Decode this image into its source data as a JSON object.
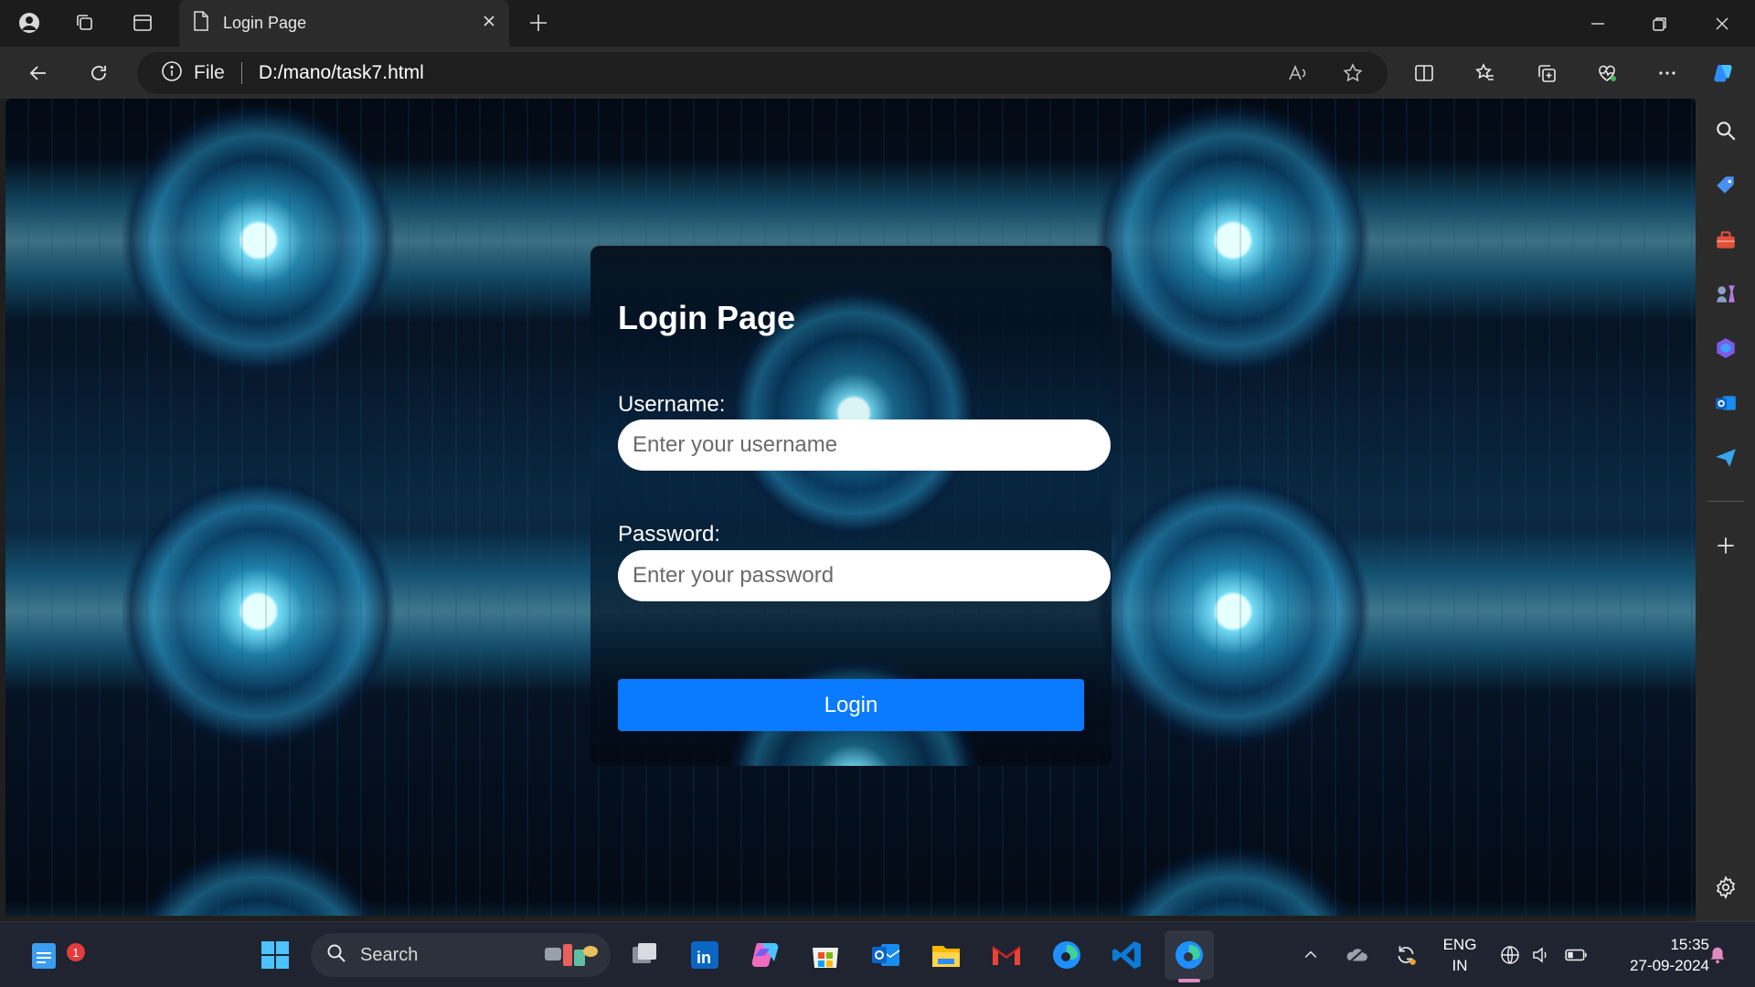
{
  "tab": {
    "title": "Login Page"
  },
  "address": {
    "scheme_label": "File",
    "url": "D:/mano/task7.html"
  },
  "page": {
    "title": "Login Page",
    "username_label": "Username:",
    "username_placeholder": "Enter your username",
    "password_label": "Password:",
    "password_placeholder": "Enter your password",
    "login_label": "Login"
  },
  "taskbar": {
    "search_label": "Search",
    "notification_count": "1",
    "lang_line1": "ENG",
    "lang_line2": "IN",
    "time": "15:35",
    "date": "27-09-2024"
  },
  "colors": {
    "accent": "#0a7bfe",
    "chrome": "#2b2b2b",
    "taskbar": "#1f2430"
  }
}
